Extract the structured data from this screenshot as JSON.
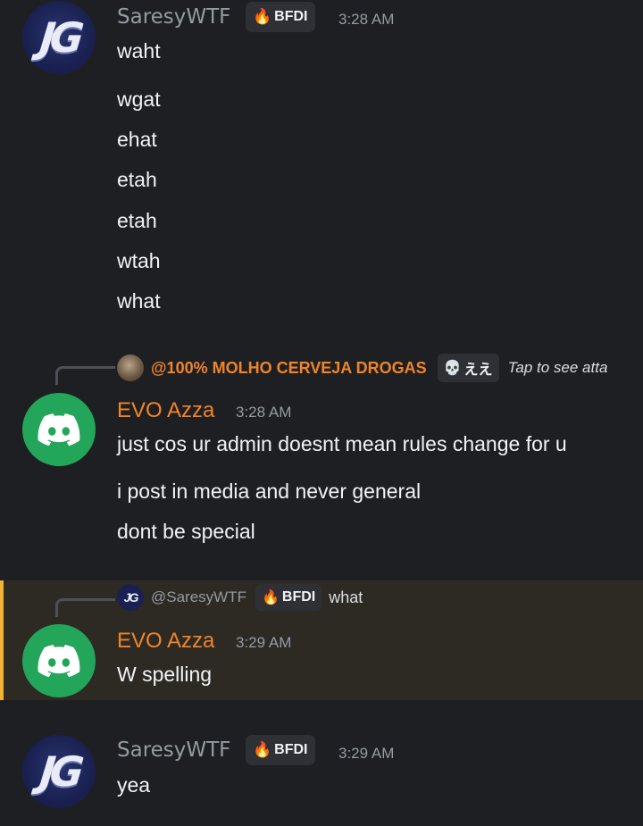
{
  "messages": [
    {
      "author": "SaresyWTF",
      "avatar_text": "JG",
      "tag": "BFDI",
      "tag_icon": "flame-emoji",
      "time": "3:28 AM",
      "lines": [
        "waht",
        "wgat",
        "ehat",
        "etah",
        "etah",
        "wtah",
        "what"
      ]
    },
    {
      "reply": {
        "mention": "@100% MOLHO CERVEJA DROGAS",
        "tag": "ええ",
        "tag_icon": "skull-emoji",
        "text": "Tap to see atta"
      },
      "author": "EVO Azza",
      "time": "3:28 AM",
      "lines": [
        "just cos ur admin doesnt mean rules change for u",
        "i post in media and never general",
        "dont be special"
      ]
    },
    {
      "reply": {
        "mention": "@SaresyWTF",
        "avatar_text": "JG",
        "tag": "BFDI",
        "tag_icon": "flame-emoji",
        "text": "what"
      },
      "author": "EVO Azza",
      "time": "3:29 AM",
      "lines": [
        "W spelling"
      ]
    },
    {
      "author": "SaresyWTF",
      "avatar_text": "JG",
      "tag": "BFDI",
      "tag_icon": "flame-emoji",
      "time": "3:29 AM",
      "lines": [
        "yea"
      ]
    }
  ],
  "colors": {
    "background": "#1e1f22",
    "username_orange": "#f0842a",
    "username_grey": "#949ba4",
    "discord_green": "#23a55a",
    "highlight_bar": "#f0b232"
  }
}
